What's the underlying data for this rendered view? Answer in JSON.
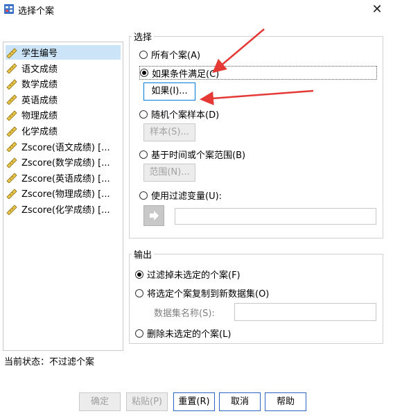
{
  "window": {
    "title": "选择个案",
    "close_glyph": "✕"
  },
  "variables": [
    {
      "name": "学生编号",
      "icon": "ruler-icon"
    },
    {
      "name": "语文成绩",
      "icon": "ruler-icon"
    },
    {
      "name": "数学成绩",
      "icon": "ruler-icon"
    },
    {
      "name": "英语成绩",
      "icon": "ruler-icon"
    },
    {
      "name": "物理成绩",
      "icon": "ruler-icon"
    },
    {
      "name": "化学成绩",
      "icon": "ruler-icon"
    },
    {
      "name": "Zscore(语文成绩) [...",
      "icon": "ruler-icon"
    },
    {
      "name": "Zscore(数学成绩) [...",
      "icon": "ruler-icon"
    },
    {
      "name": "Zscore(英语成绩) [...",
      "icon": "ruler-icon"
    },
    {
      "name": "Zscore(物理成绩) [...",
      "icon": "ruler-icon"
    },
    {
      "name": "Zscore(化学成绩) [...",
      "icon": "ruler-icon"
    }
  ],
  "select_group": {
    "title": "选择",
    "all_cases": "所有个案(A)",
    "if_condition": "如果条件满足(C)",
    "if_button": "如果(I)...",
    "random_sample": "随机个案样本(D)",
    "sample_button": "样本(S)...",
    "time_range": "基于时间或个案范围(B)",
    "range_button": "范围(N)...",
    "filter_variable": "使用过滤变量(U):"
  },
  "output_group": {
    "title": "输出",
    "filter_out": "过滤掉未选定的个案(F)",
    "copy_new": "将选定个案复制到新数据集(O)",
    "dataset_name_label": "数据集名称(S):",
    "delete": "删除未选定的个案(L)"
  },
  "status": "当前状态：不过滤个案",
  "buttons": {
    "ok": "确定",
    "paste": "粘贴(P)",
    "reset": "重置(R)",
    "cancel": "取消",
    "help": "帮助"
  },
  "colors": {
    "selection": "#cce4f7",
    "annotation_arrow": "#e53935",
    "focus_border": "#0078d7"
  }
}
